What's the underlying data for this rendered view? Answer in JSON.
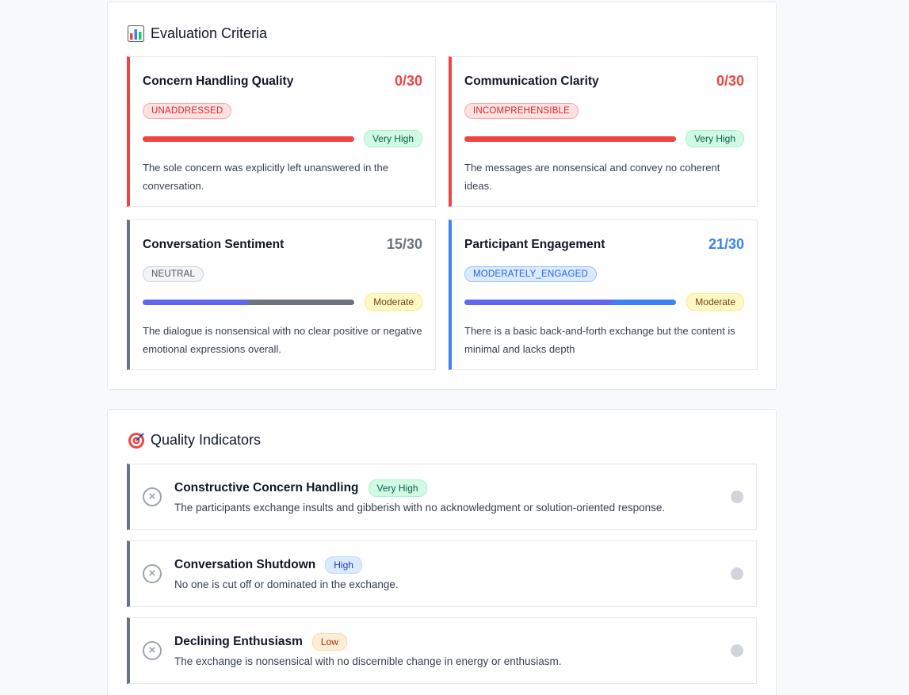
{
  "evaluation": {
    "title": "Evaluation Criteria",
    "icon": "bar-chart-icon",
    "cards": [
      {
        "title": "Concern Handling Quality",
        "score": "0/30",
        "status": "UNADDRESSED",
        "level": "Very High",
        "description": "The sole concern was explicitly left unanswered in the conversation.",
        "accent": "#ef4444",
        "progress": 0
      },
      {
        "title": "Communication Clarity",
        "score": "0/30",
        "status": "INCOMPREHENSIBLE",
        "level": "Very High",
        "description": "The messages are nonsensical and convey no coherent ideas.",
        "accent": "#ef4444",
        "progress": 0
      },
      {
        "title": "Conversation Sentiment",
        "score": "15/30",
        "status": "NEUTRAL",
        "level": "Moderate",
        "description": "The dialogue is nonsensical with no clear positive or negative emotional expressions overall.",
        "accent": "#6b7280",
        "progress": 0.5
      },
      {
        "title": "Participant Engagement",
        "score": "21/30",
        "status": "MODERATELY_ENGAGED",
        "level": "Moderate",
        "description": "There is a basic back-and-forth exchange but the content is minimal and lacks depth",
        "accent": "#3b82f6",
        "progress": 0.7
      }
    ]
  },
  "quality": {
    "title": "Quality Indicators",
    "icon": "target-icon",
    "items": [
      {
        "title": "Constructive Concern Handling",
        "badge": "Very High",
        "description": "The participants exchange insults and gibberish with no acknowledgment or solution-oriented response."
      },
      {
        "title": "Conversation Shutdown",
        "badge": "High",
        "description": "No one is cut off or dominated in the exchange."
      },
      {
        "title": "Declining Enthusiasm",
        "badge": "Low",
        "description": "The exchange is nonsensical with no discernible change in energy or enthusiasm."
      }
    ]
  },
  "colors": {
    "red": "#ef4444",
    "gray": "#6b7280",
    "blue": "#3b82f6",
    "indigo": "#6366f1",
    "green_badge": "#d1fae5",
    "yellow_badge": "#fef9c3",
    "blue_badge": "#dbeafe",
    "orange_badge": "#ffedd5"
  }
}
